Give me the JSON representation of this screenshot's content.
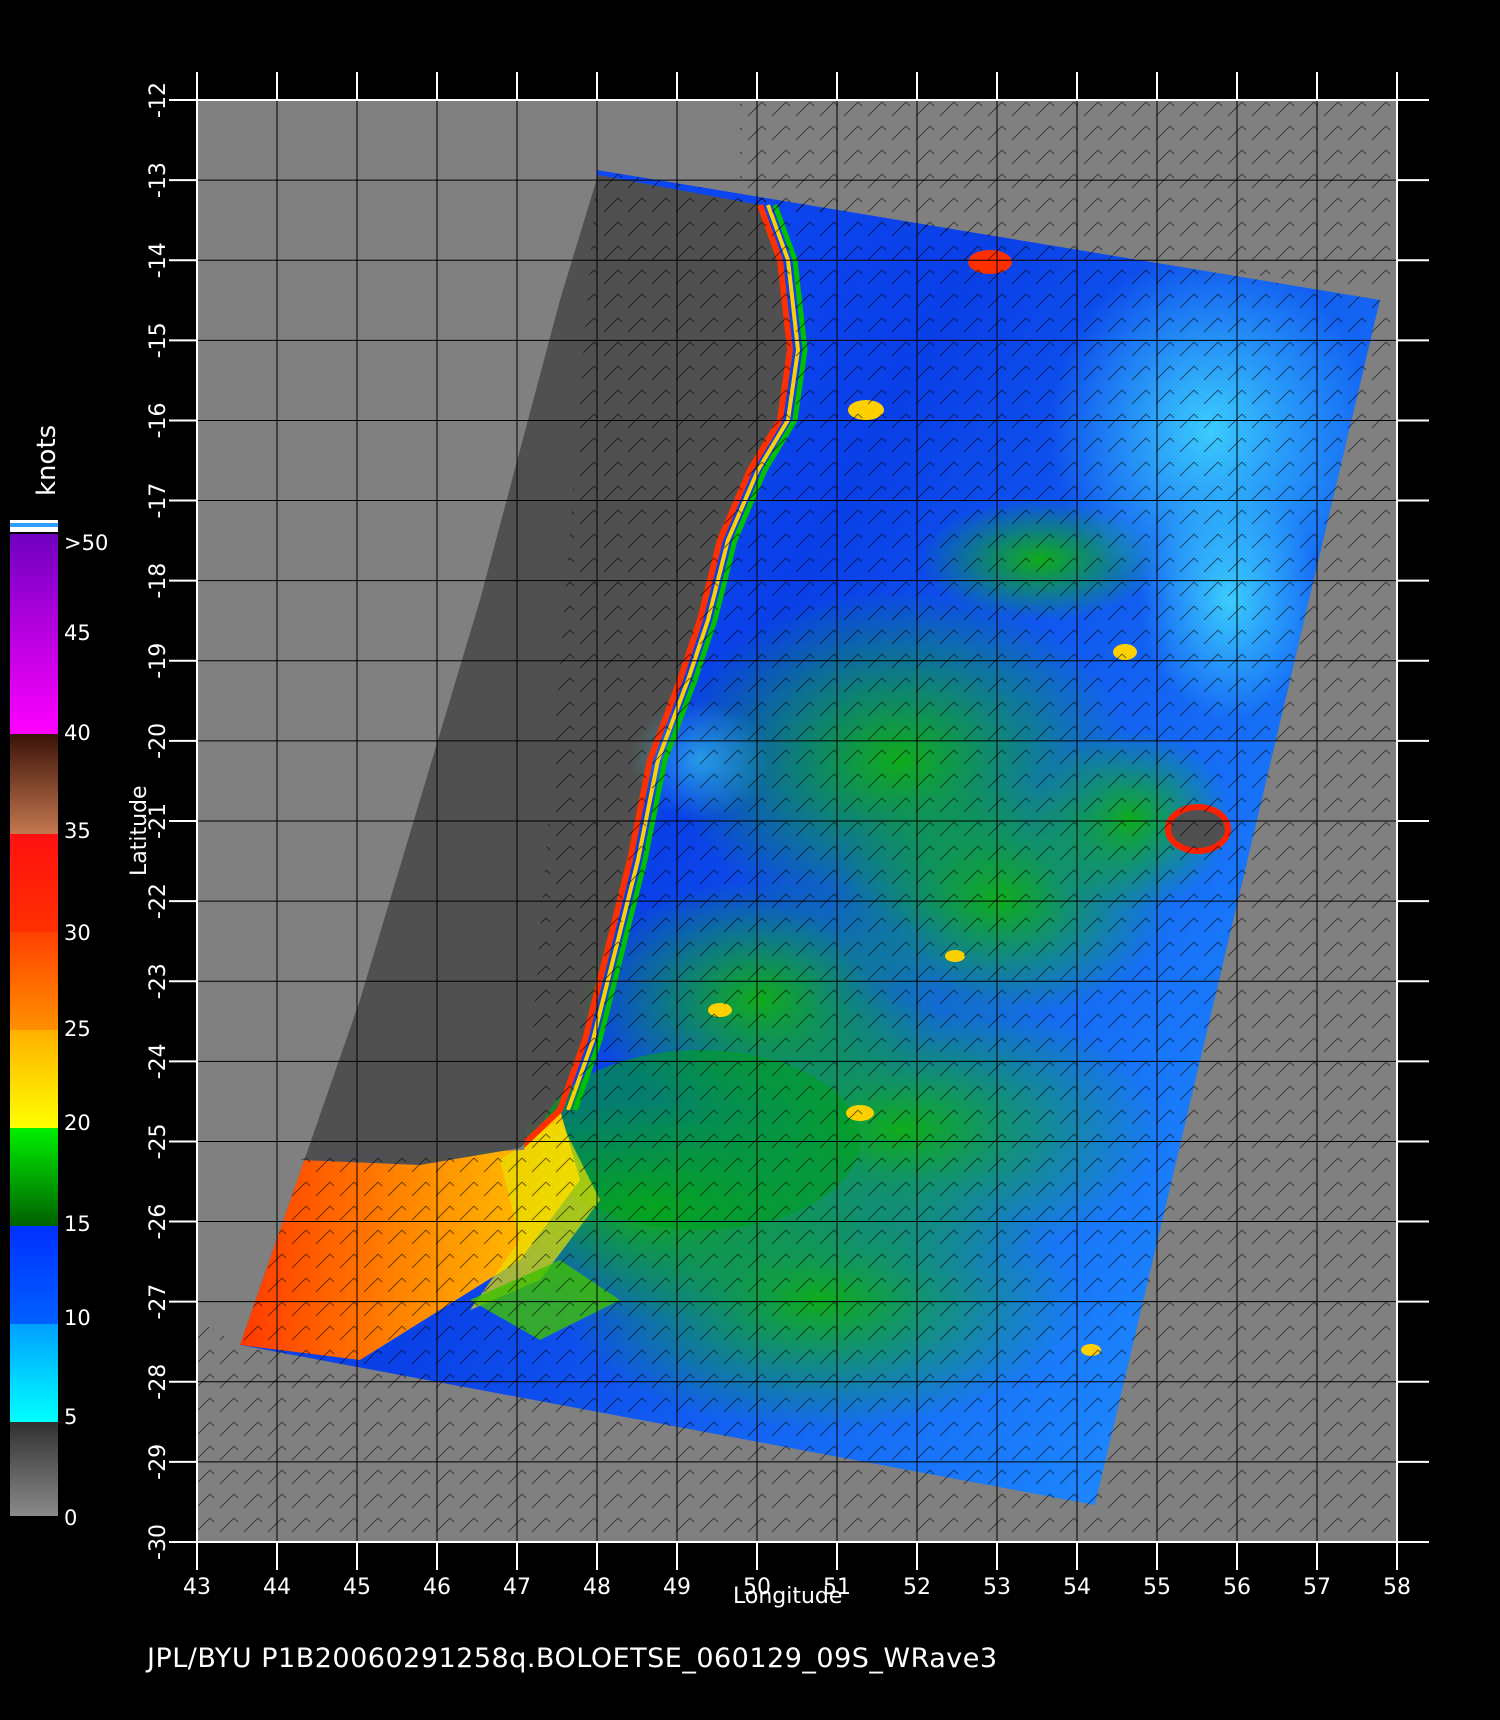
{
  "footer": "JPL/BYU  P1B20060291258q.BOLOETSE_060129_09S_WRave3",
  "axes": {
    "xlabel": "Longitude",
    "ylabel": "Latitude",
    "x_ticks": [
      "43",
      "44",
      "45",
      "46",
      "47",
      "48",
      "49",
      "50",
      "51",
      "52",
      "53",
      "54",
      "55",
      "56",
      "57",
      "58"
    ],
    "y_ticks": [
      "-12",
      "-13",
      "-14",
      "-15",
      "-16",
      "-17",
      "-18",
      "-19",
      "-20",
      "-21",
      "-22",
      "-23",
      "-24",
      "-25",
      "-26",
      "-27",
      "-28",
      "-29",
      "-30"
    ],
    "lon_range": [
      43,
      58
    ],
    "lat_range": [
      -30,
      -12
    ]
  },
  "legend": {
    "unit": "knots",
    "labels": [
      ">50",
      "45",
      "40",
      "35",
      "30",
      "25",
      "20",
      "15",
      "10",
      "5",
      "0"
    ],
    "colors": {
      "0-5": "#4a4a4a",
      "5-10": "#00e8ff",
      "10-15": "#0040ff",
      "15-20": "#00b000",
      "20-25": "#ffe000",
      "25-30": "#ff7000",
      "30-35": "#ff1a00",
      "35-40": "#8a3a20",
      "40-45": "#ff00ff",
      "45-50": "#8000c0"
    }
  },
  "colors": {
    "background": "#000000",
    "map_out_of_swath": "#808080",
    "land": "#505050",
    "grid": "#000000"
  }
}
